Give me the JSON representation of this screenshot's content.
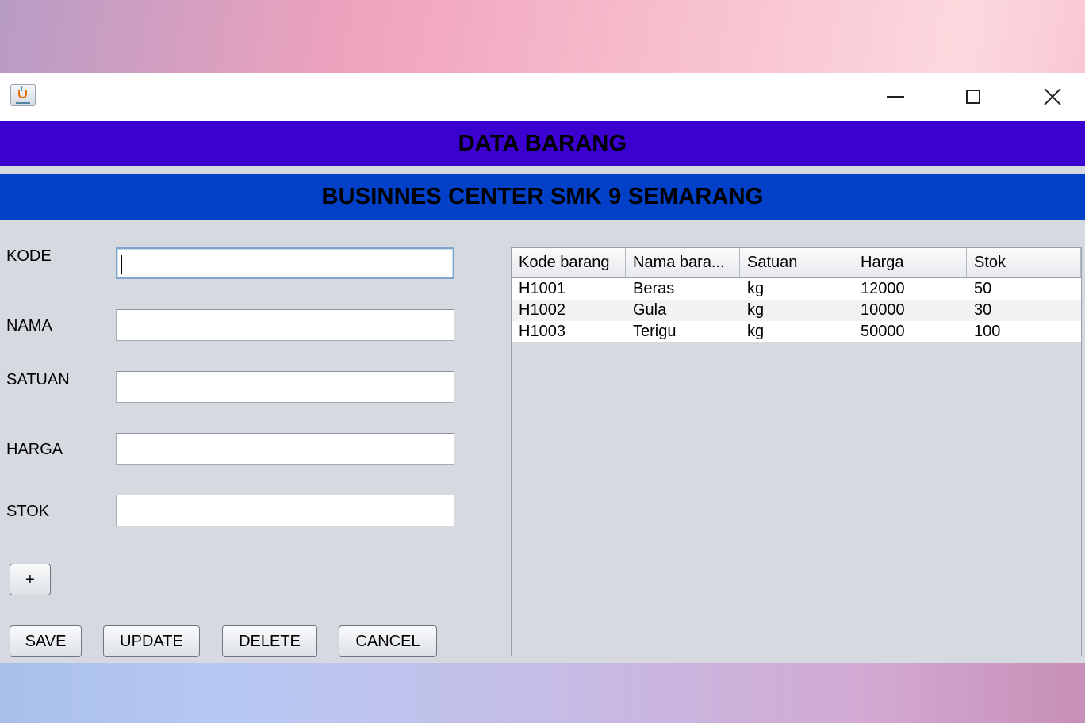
{
  "window": {
    "icon": "java-cup-icon",
    "controls": [
      "minimize-icon",
      "maximize-icon",
      "close-icon"
    ]
  },
  "banners": {
    "title": "DATA BARANG",
    "subtitle": "BUSINNES CENTER SMK 9 SEMARANG"
  },
  "form": {
    "fields": [
      {
        "label": "KODE",
        "value": ""
      },
      {
        "label": "NAMA",
        "value": ""
      },
      {
        "label": "SATUAN",
        "value": ""
      },
      {
        "label": "HARGA",
        "value": ""
      },
      {
        "label": "STOK",
        "value": ""
      }
    ],
    "add_label": "+",
    "buttons": [
      "SAVE",
      "UPDATE",
      "DELETE",
      "CANCEL"
    ]
  },
  "table": {
    "columns": [
      "Kode barang",
      "Nama bara...",
      "Satuan",
      "Harga",
      "Stok"
    ],
    "rows": [
      [
        "H1001",
        "Beras",
        "kg",
        "12000",
        "50"
      ],
      [
        "H1002",
        "Gula",
        "kg",
        "10000",
        "30"
      ],
      [
        "H1003",
        "Terigu",
        "kg",
        "50000",
        "100"
      ]
    ]
  },
  "colors": {
    "banner_title_bg": "#3b01cf",
    "banner_subtitle_bg": "#0240c8",
    "panel_bg": "#d6d9e0"
  }
}
